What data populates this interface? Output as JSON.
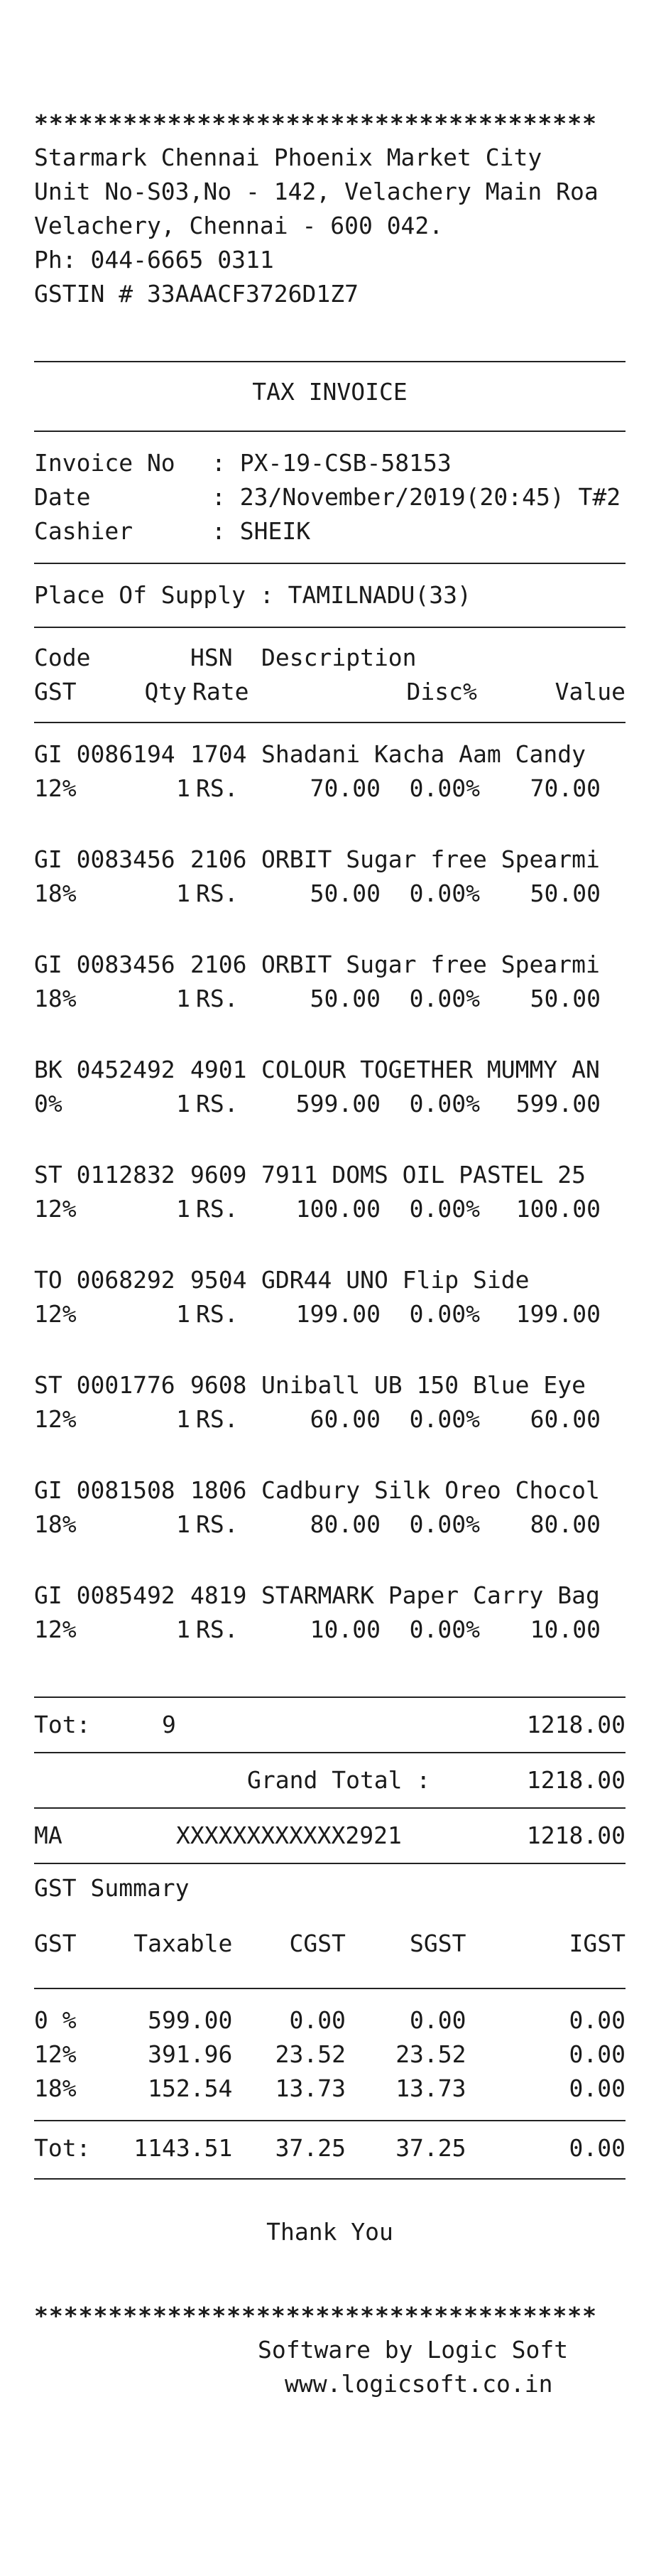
{
  "store": {
    "stars_top": "******************************************",
    "name": "Starmark Chennai Phoenix Market City",
    "address1": "Unit No-S03,No - 142, Velachery Main Roa",
    "address2": "Velachery, Chennai - 600 042.",
    "phone": "Ph: 044-6665 0311",
    "gstin": "GSTIN # 33AAACF3726D1Z7"
  },
  "title": "TAX INVOICE",
  "invoice": {
    "invoice_no_label": "Invoice No",
    "invoice_no": ": PX-19-CSB-58153",
    "date_label": "Date",
    "date": ": 23/November/2019(20:45) T#2",
    "cashier_label": "Cashier",
    "cashier": ": SHEIK"
  },
  "place_of_supply": "Place Of Supply : TAMILNADU(33)",
  "columns": {
    "code": "Code",
    "hsn": "HSN",
    "description": "Description",
    "gst": "GST",
    "qty": "Qty",
    "rate": "Rate",
    "disc": "Disc%",
    "value": "Value"
  },
  "items": [
    {
      "code": "GI 0086194",
      "hsn": "1704",
      "desc": "Shadani Kacha Aam Candy",
      "gst": "12%",
      "qty": "1",
      "rs": "RS.",
      "rate": "70.00",
      "disc": "0.00%",
      "value": "70.00"
    },
    {
      "code": "GI 0083456",
      "hsn": "2106",
      "desc": "ORBIT Sugar free Spearmi",
      "gst": "18%",
      "qty": "1",
      "rs": "RS.",
      "rate": "50.00",
      "disc": "0.00%",
      "value": "50.00"
    },
    {
      "code": "GI 0083456",
      "hsn": "2106",
      "desc": "ORBIT Sugar free Spearmi",
      "gst": "18%",
      "qty": "1",
      "rs": "RS.",
      "rate": "50.00",
      "disc": "0.00%",
      "value": "50.00"
    },
    {
      "code": "BK 0452492",
      "hsn": "4901",
      "desc": "COLOUR TOGETHER MUMMY AN",
      "gst": "0%",
      "qty": "1",
      "rs": "RS.",
      "rate": "599.00",
      "disc": "0.00%",
      "value": "599.00"
    },
    {
      "code": "ST 0112832",
      "hsn": "9609",
      "desc": "7911 DOMS OIL PASTEL 25",
      "gst": "12%",
      "qty": "1",
      "rs": "RS.",
      "rate": "100.00",
      "disc": "0.00%",
      "value": "100.00"
    },
    {
      "code": "TO 0068292",
      "hsn": "9504",
      "desc": "GDR44 UNO Flip Side",
      "gst": "12%",
      "qty": "1",
      "rs": "RS.",
      "rate": "199.00",
      "disc": "0.00%",
      "value": "199.00"
    },
    {
      "code": "ST 0001776",
      "hsn": "9608",
      "desc": "Uniball UB 150 Blue Eye",
      "gst": "12%",
      "qty": "1",
      "rs": "RS.",
      "rate": "60.00",
      "disc": "0.00%",
      "value": "60.00"
    },
    {
      "code": "GI 0081508",
      "hsn": "1806",
      "desc": "Cadbury Silk Oreo Chocol",
      "gst": "18%",
      "qty": "1",
      "rs": "RS.",
      "rate": "80.00",
      "disc": "0.00%",
      "value": "80.00"
    },
    {
      "code": "GI 0085492",
      "hsn": "4819",
      "desc": "STARMARK Paper Carry Bag",
      "gst": "12%",
      "qty": "1",
      "rs": "RS.",
      "rate": "10.00",
      "disc": "0.00%",
      "value": "10.00"
    }
  ],
  "totals": {
    "tot_label": "Tot:",
    "tot_qty": "9",
    "tot_value": "1218.00",
    "grand_label": "Grand Total :",
    "grand_value": "1218.00",
    "pay_mode": "MA",
    "pay_card": "XXXXXXXXXXXX2921",
    "pay_value": "1218.00"
  },
  "gst_summary": {
    "title": "GST Summary",
    "headers": {
      "gst": "GST",
      "taxable": "Taxable",
      "cgst": "CGST",
      "sgst": "SGST",
      "igst": "IGST"
    },
    "rows": [
      {
        "gst": "0 %",
        "taxable": "599.00",
        "cgst": "0.00",
        "sgst": "0.00",
        "igst": "0.00"
      },
      {
        "gst": "12%",
        "taxable": "391.96",
        "cgst": "23.52",
        "sgst": "23.52",
        "igst": "0.00"
      },
      {
        "gst": "18%",
        "taxable": "152.54",
        "cgst": "13.73",
        "sgst": "13.73",
        "igst": "0.00"
      }
    ],
    "total": {
      "gst": "Tot:",
      "taxable": "1143.51",
      "cgst": "37.25",
      "sgst": "37.25",
      "igst": "0.00"
    }
  },
  "thank_you": "Thank You",
  "stars_bottom": "******************************************",
  "software": "Software by Logic Soft",
  "website": "www.logicsoft.co.in"
}
